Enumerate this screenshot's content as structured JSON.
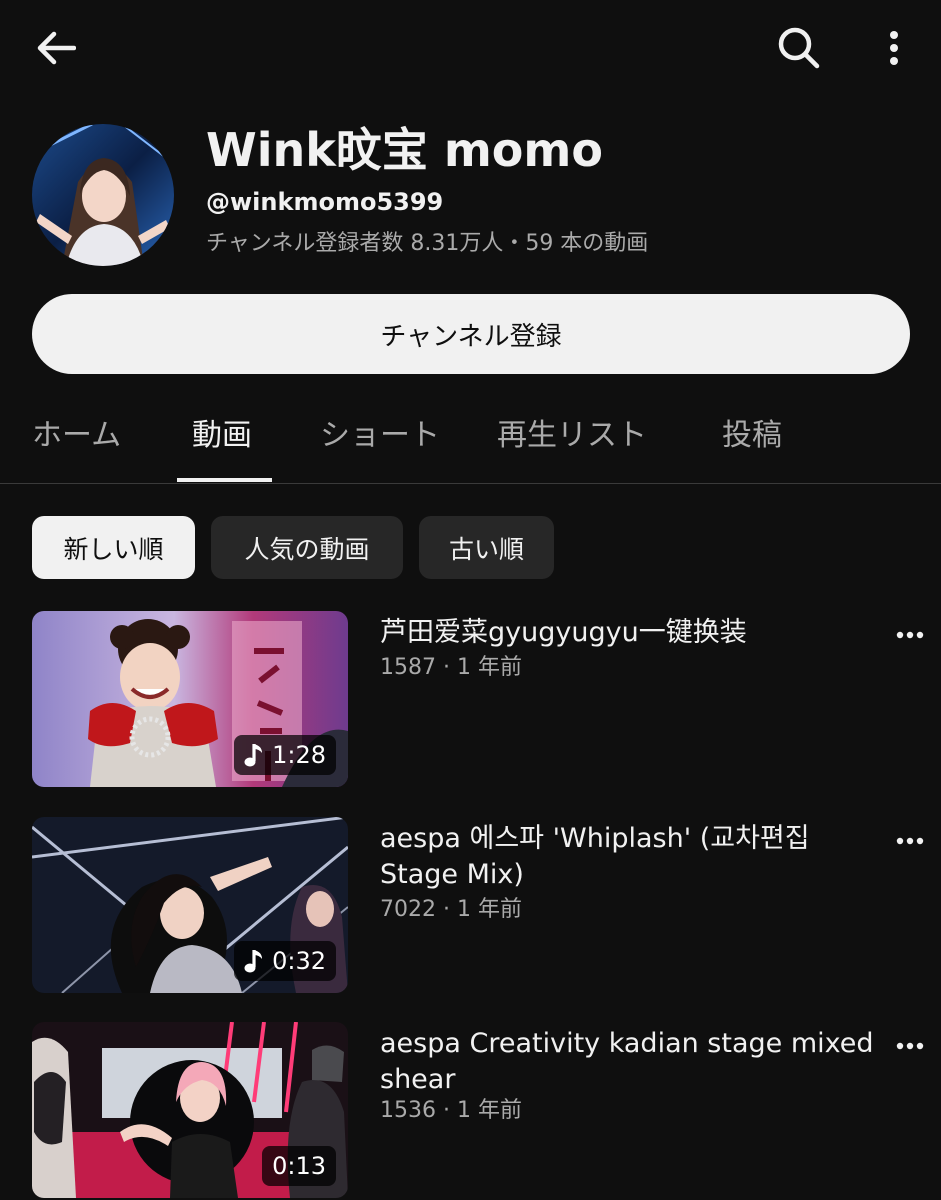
{
  "topbar": {
    "back_icon": "back-arrow-icon",
    "search_icon": "search-icon",
    "more_icon": "more-vert-icon"
  },
  "channel": {
    "title": "Wink旼宝 momo",
    "handle": "@winkmomo5399",
    "meta": "チャンネル登録者数 8.31万人・59 本の動画",
    "subscribe_label": "チャンネル登録"
  },
  "tabs": [
    "ホーム",
    "動画",
    "ショート",
    "再生リスト",
    "投稿"
  ],
  "active_tab": "動画",
  "chips": [
    "新しい順",
    "人気の動画",
    "古い順"
  ],
  "selected_chip": "新しい順",
  "videos": [
    {
      "title": "芦田爱菜gyugyugyu一键换装",
      "meta": "1587 · 1 年前",
      "duration": "1:28",
      "music_icon": true
    },
    {
      "title": "aespa 에스파 'Whiplash' (교차편집 Stage Mix)",
      "meta": "7022 · 1 年前",
      "duration": "0:32",
      "music_icon": true
    },
    {
      "title": "aespa  Creativity kadian stage mixed shear",
      "meta": "1536 · 1 年前",
      "duration": "0:13",
      "music_icon": false
    }
  ],
  "colors": {
    "background": "#0f0f0f",
    "text": "#f1f1f1",
    "secondary_text": "#aaaaaa",
    "chip_bg": "#272727"
  }
}
